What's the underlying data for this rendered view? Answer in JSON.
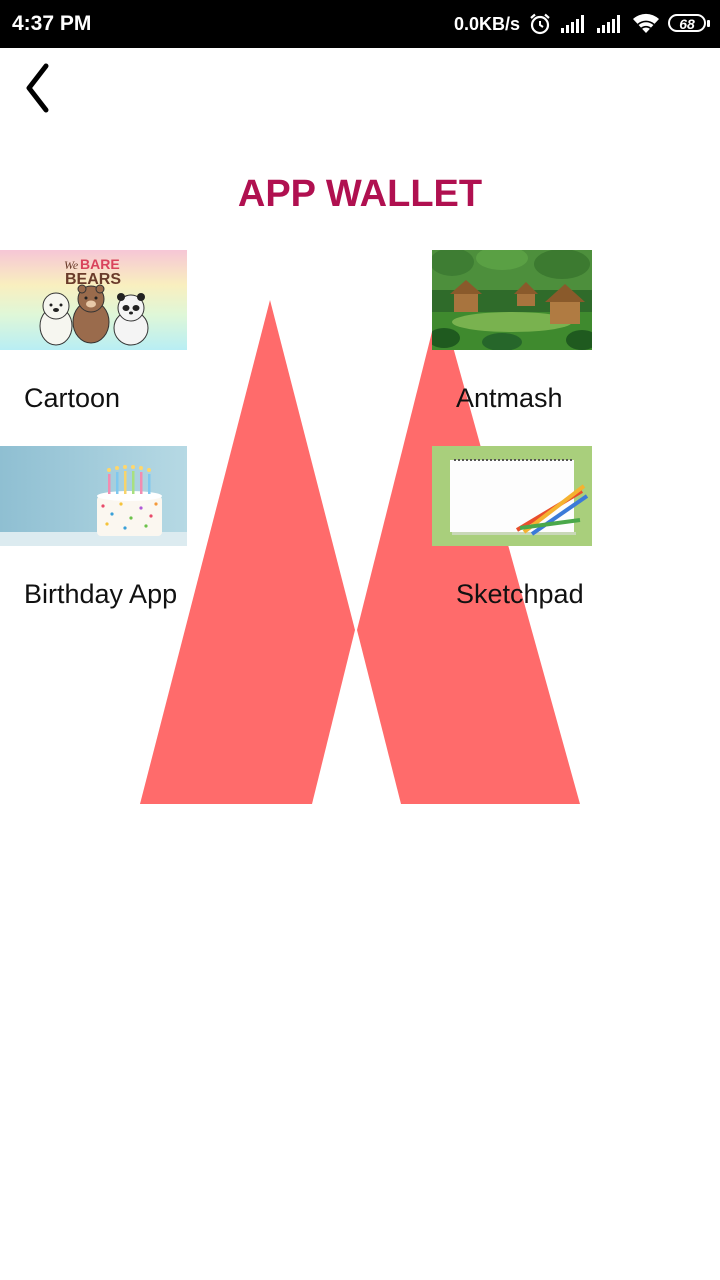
{
  "status_bar": {
    "time": "4:37 PM",
    "network_speed": "0.0KB/s",
    "battery_level": "68",
    "icons": [
      "alarm-icon",
      "signal-icon",
      "signal-icon",
      "wifi-icon",
      "battery-icon"
    ]
  },
  "header": {
    "back_icon": "chevron-left-icon",
    "title": "APP WALLET"
  },
  "apps": [
    {
      "label": "Cartoon",
      "thumbnail": "cartoon-thumbnail",
      "thumbnail_text": [
        "We",
        "BARE",
        "BEARS"
      ]
    },
    {
      "label": "Antmash",
      "thumbnail": "antmash-thumbnail"
    },
    {
      "label": "Birthday App",
      "thumbnail": "birthday-thumbnail"
    },
    {
      "label": "Sketchpad",
      "thumbnail": "sketchpad-thumbnail"
    }
  ],
  "colors": {
    "title": "#b01050",
    "background_logo": "#ff6b6b",
    "status_bar": "#000000"
  }
}
